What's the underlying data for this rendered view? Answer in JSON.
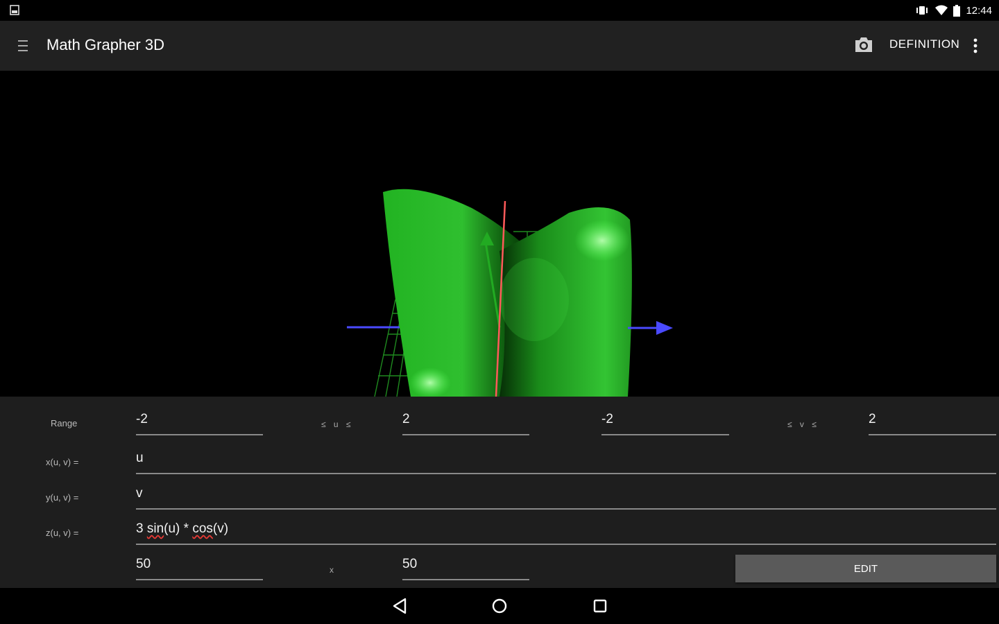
{
  "status_bar": {
    "time": "12:44",
    "icons": [
      "notification-icon",
      "vibrate-icon",
      "wifi-icon",
      "battery-icon"
    ]
  },
  "app_bar": {
    "title": "Math Grapher 3D",
    "definition_label": "DEFINITION",
    "icons": [
      "menu-icon",
      "camera-icon",
      "overflow-menu-icon"
    ]
  },
  "graph": {
    "surface_color": "#2ecc40",
    "x_axis_color": "#4a4aff",
    "y_axis_color": "#ff4a4a",
    "z_axis_color": "#22aa22"
  },
  "definition_panel": {
    "range_label": "Range",
    "u_min": "-2",
    "u_separator": "≤ u ≤",
    "u_max": "2",
    "v_min": "-2",
    "v_separator": "≤ v ≤",
    "v_max": "2",
    "x_label": "x(u, v) =",
    "x_expr": "u",
    "y_label": "y(u, v) =",
    "y_expr": "v",
    "z_label": "z(u, v) =",
    "z_expr_prefix": "3 ",
    "z_expr_sin": "sin",
    "z_expr_mid": "(u) * ",
    "z_expr_cos": "cos",
    "z_expr_suffix": "(v)",
    "grid_u": "50",
    "grid_separator": "x",
    "grid_v": "50",
    "edit_label": "EDIT"
  },
  "nav_bar": {
    "buttons": [
      "back-icon",
      "home-icon",
      "recents-icon"
    ]
  }
}
